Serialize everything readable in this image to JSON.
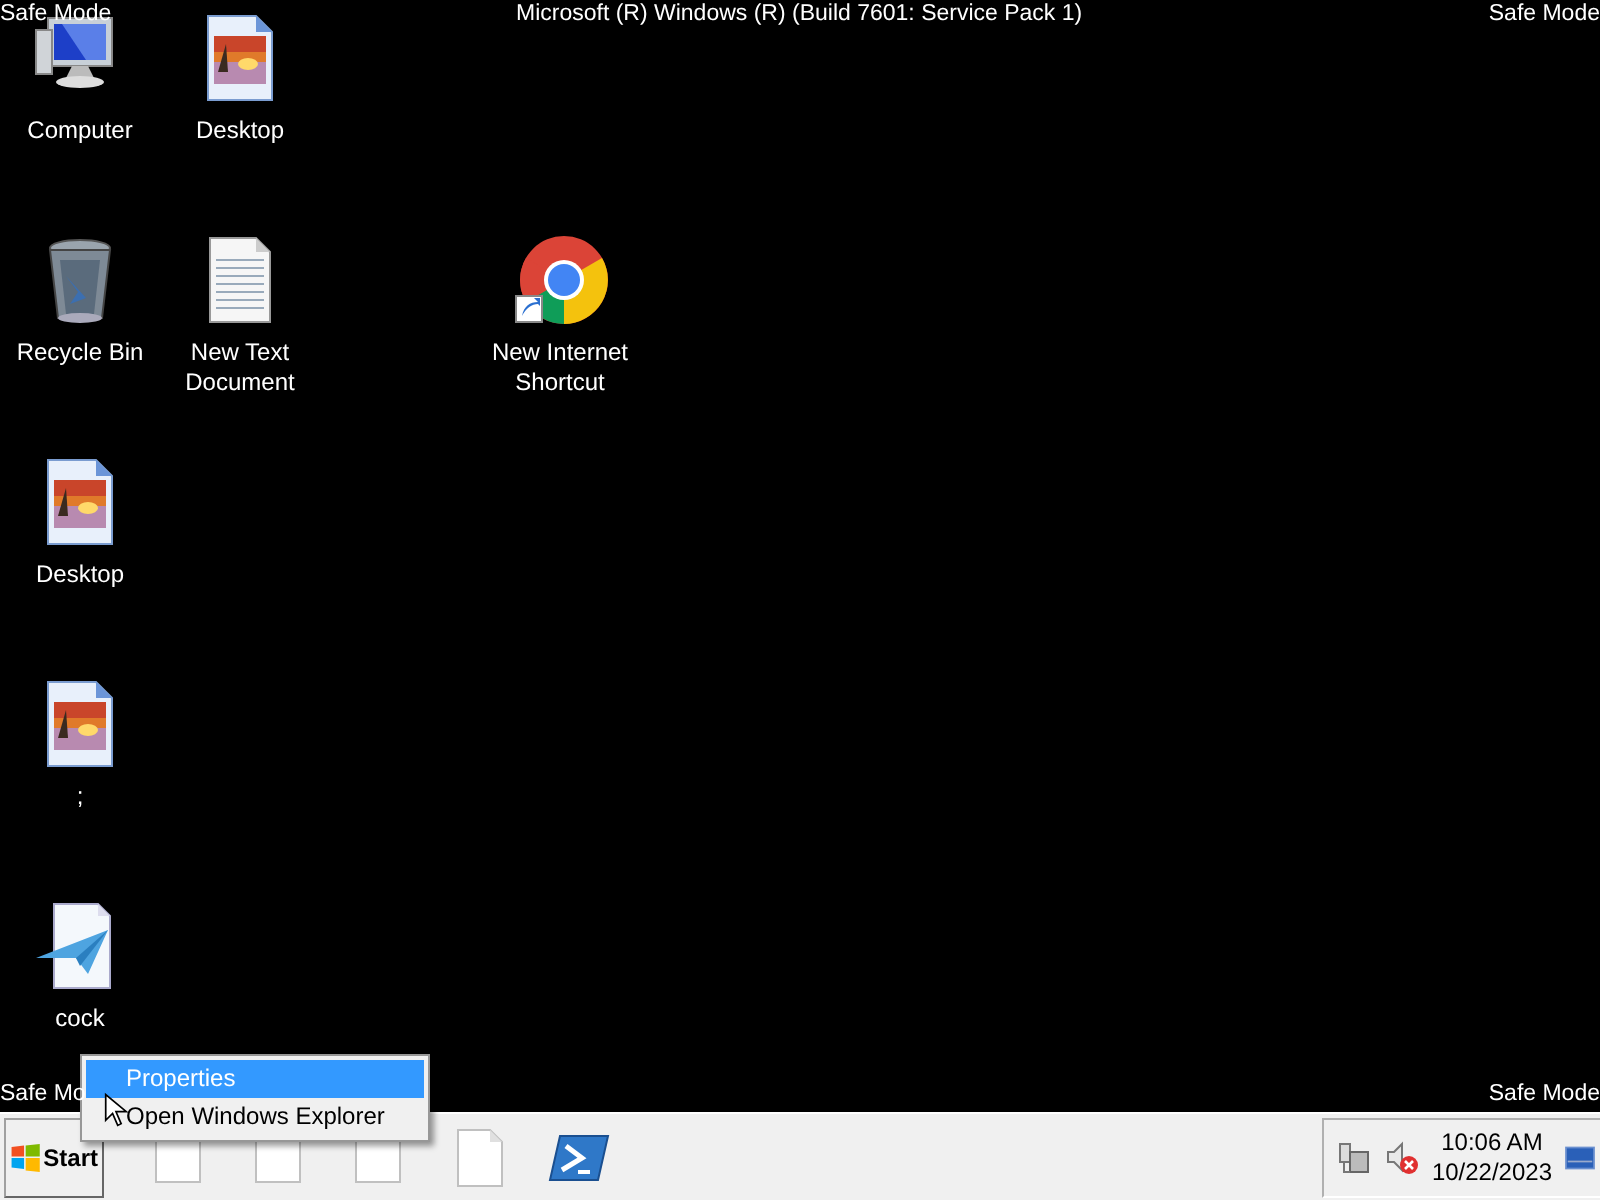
{
  "corner_labels": {
    "top_left": "Safe Mode",
    "top_center": "Microsoft (R) Windows (R) (Build 7601: Service Pack 1)",
    "top_right": "Safe Mode",
    "bottom_left": "Safe Mo",
    "bottom_right": "Safe Mode"
  },
  "desktop_icons": [
    {
      "kind": "computer",
      "label": "Computer"
    },
    {
      "kind": "image",
      "label": "Desktop"
    },
    {
      "kind": "recycle",
      "label": "Recycle Bin"
    },
    {
      "kind": "text",
      "label": "New Text Document"
    },
    {
      "kind": "browser",
      "label": "New Internet Shortcut"
    },
    {
      "kind": "image",
      "label": "Desktop"
    },
    {
      "kind": "image",
      "label": ";"
    },
    {
      "kind": "plane",
      "label": "cock"
    }
  ],
  "context_menu": [
    {
      "label": "Properties",
      "selected": true
    },
    {
      "label": "Open Windows Explorer",
      "selected": false
    }
  ],
  "taskbar": {
    "start": "Start",
    "buttons": [
      {
        "kind": "page"
      },
      {
        "kind": "page"
      },
      {
        "kind": "page"
      },
      {
        "kind": "file"
      },
      {
        "kind": "shell"
      }
    ],
    "tray": [
      {
        "kind": "network"
      },
      {
        "kind": "volume",
        "muted": true
      }
    ],
    "time": "10:06 AM",
    "date": "10/22/2023"
  }
}
